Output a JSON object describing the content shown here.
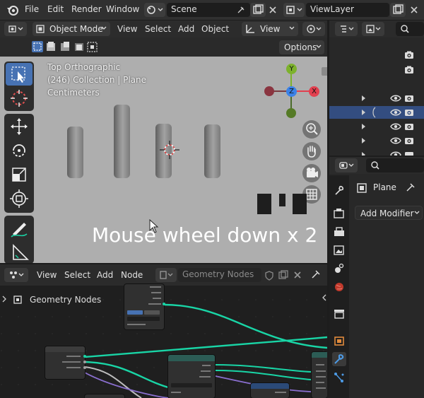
{
  "topbar": {
    "menus": [
      "File",
      "Edit",
      "Render",
      "Window"
    ],
    "scene_label": "Scene",
    "viewlayer_label": "ViewLayer"
  },
  "viewport": {
    "header": {
      "mode": "Object Mode",
      "menus": [
        "View",
        "Select",
        "Add",
        "Object"
      ],
      "transform_orientation": "View"
    },
    "options_label": "Options",
    "info": {
      "view_name": "Top Orthographic",
      "collection_line": "(246) Collection | Plane",
      "units": "Centimeters"
    },
    "gizmo": {
      "y_label": "Y",
      "z_label": "Z",
      "x_label": "X",
      "colors": {
        "x": "#e2404f",
        "y": "#7db22c",
        "z": "#3b82e8"
      }
    },
    "tools": [
      "select-box",
      "cursor",
      "move",
      "rotate",
      "scale",
      "transform",
      "annotate",
      "measure"
    ]
  },
  "overlay": {
    "text": "Mouse wheel down x 2"
  },
  "node_editor": {
    "menus": [
      "View",
      "Select",
      "Add",
      "Node"
    ],
    "tree_name": "Geometry Nodes",
    "breadcrumb": "Geometry Nodes"
  },
  "properties": {
    "object_name": "Plane",
    "add_modifier_label": "Add Modifier"
  },
  "colors": {
    "accent": "#4772b3",
    "selected_row": "#334d80",
    "link_geometry": "#19d5a6"
  }
}
